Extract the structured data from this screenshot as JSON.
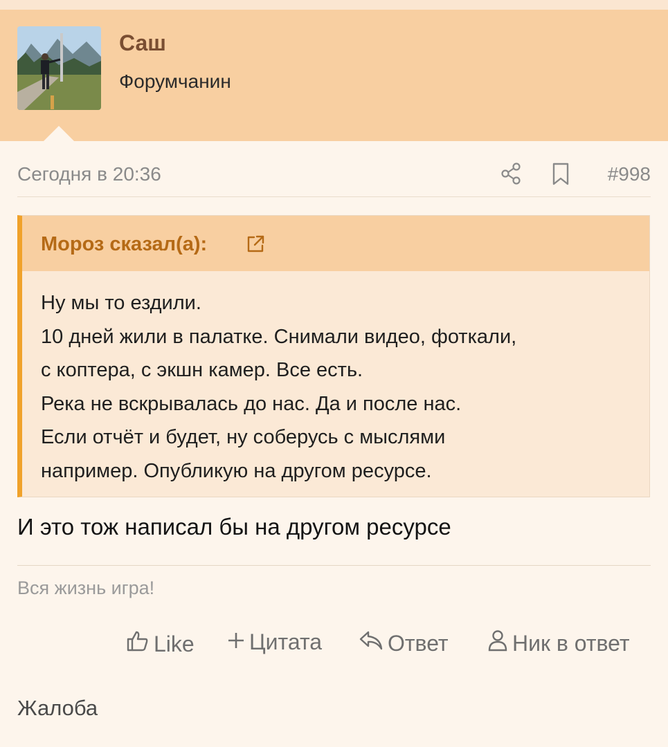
{
  "user": {
    "name": "Саш",
    "title": "Форумчанин"
  },
  "post": {
    "date": "Сегодня в 20:36",
    "number": "#998",
    "quote": {
      "author": "Мороз сказал(а):",
      "lines": [
        "Ну мы то ездили.",
        "10 дней жили в палатке. Снимали видео, фоткали,",
        "с коптера, с экшн камер. Все есть.",
        "Река не вскрывалась до нас. Да и после нас.",
        "Если отчёт и будет, ну соберусь с мыслями",
        "например. Опубликую на другом ресурсе."
      ]
    },
    "text": "И это тож написал бы на другом ресурсе",
    "signature": "Вся жизнь игра!"
  },
  "actions": {
    "like": "Like",
    "quote": "Цитата",
    "reply": "Ответ",
    "mention": "Ник в ответ"
  },
  "report": "Жалоба",
  "icons": [
    "share-icon",
    "bookmark-icon",
    "external-link-icon",
    "thumbs-up-icon",
    "plus-icon",
    "reply-icon",
    "user-icon"
  ],
  "colors": {
    "header_bg": "#f8cfa1",
    "accent": "#f0a22a",
    "quote_author": "#b56a16",
    "username": "#7a4e32",
    "page_bg": "#fdf5ec"
  }
}
